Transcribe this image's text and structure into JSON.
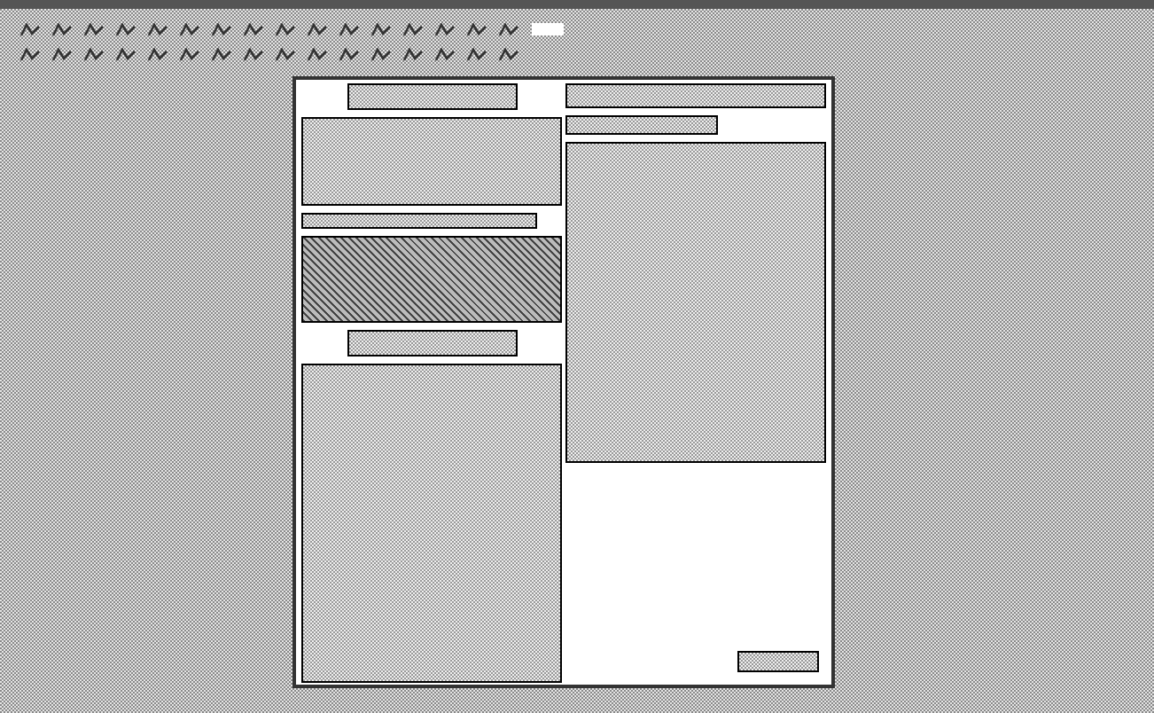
{
  "toolbars": [
    {
      "tools": [
        {
          "kind": "tool"
        },
        {
          "kind": "tool"
        },
        {
          "kind": "tool"
        },
        {
          "kind": "tool"
        },
        {
          "kind": "tool"
        },
        {
          "kind": "tool"
        },
        {
          "kind": "tool"
        },
        {
          "kind": "tool"
        },
        {
          "kind": "tool"
        },
        {
          "kind": "tool"
        },
        {
          "kind": "tool"
        },
        {
          "kind": "tool"
        },
        {
          "kind": "tool"
        },
        {
          "kind": "tool"
        },
        {
          "kind": "tool"
        },
        {
          "kind": "tool"
        },
        {
          "kind": "field"
        }
      ]
    },
    {
      "tools": [
        {
          "kind": "tool"
        },
        {
          "kind": "tool"
        },
        {
          "kind": "tool"
        },
        {
          "kind": "tool"
        },
        {
          "kind": "tool"
        },
        {
          "kind": "tool"
        },
        {
          "kind": "tool"
        },
        {
          "kind": "tool"
        },
        {
          "kind": "tool"
        },
        {
          "kind": "tool"
        },
        {
          "kind": "tool"
        },
        {
          "kind": "tool"
        },
        {
          "kind": "tool"
        },
        {
          "kind": "tool"
        },
        {
          "kind": "tool"
        },
        {
          "kind": "tool"
        }
      ]
    }
  ],
  "page": {
    "columns": [
      {
        "blocks": [
          {
            "kind": "heading"
          },
          {
            "kind": "text"
          },
          {
            "kind": "caption"
          },
          {
            "kind": "image"
          },
          {
            "kind": "heading"
          },
          {
            "kind": "fill_text"
          }
        ]
      },
      {
        "blocks": [
          {
            "kind": "title"
          },
          {
            "kind": "short_caption"
          },
          {
            "kind": "tall_text"
          },
          {
            "kind": "button"
          }
        ]
      }
    ]
  }
}
